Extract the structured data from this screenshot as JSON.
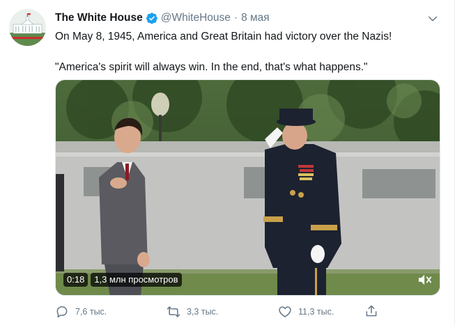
{
  "author": {
    "display_name": "The White House",
    "handle": "@WhiteHouse",
    "separator": "·",
    "date": "8 мая",
    "verified": true,
    "avatar_icon": "white-house-avatar"
  },
  "tweet": {
    "line1": "On May 8, 1945, America and Great Britain had victory over the Nazis!",
    "line2": "\"America's spirit will always win. In the end, that's what happens.\""
  },
  "video": {
    "duration": "0:18",
    "views": "1,3 млн просмотров",
    "mute_icon": "speaker-muted-icon"
  },
  "actions": {
    "reply_count": "7,6 тыс.",
    "retweet_count": "3,3 тыс.",
    "like_count": "11,3 тыс."
  },
  "colors": {
    "text_primary": "#14171a",
    "text_secondary": "#657786",
    "verified_blue": "#1da1f2"
  }
}
